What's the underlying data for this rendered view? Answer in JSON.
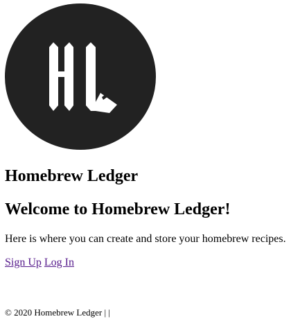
{
  "brand": {
    "logo_icon": "hl-monogram-icon",
    "logo_bg_color": "#222222",
    "logo_fg_color": "#ffffff",
    "title": "Homebrew Ledger"
  },
  "main": {
    "heading": "Welcome to Homebrew Ledger!",
    "intro": "Here is where you can create and store your homebrew recipes."
  },
  "nav": {
    "sign_up_label": "Sign Up",
    "log_in_label": "Log In",
    "link_color": "#551a8b"
  },
  "footer": {
    "text": "© 2020 Homebrew Ledger | |"
  }
}
